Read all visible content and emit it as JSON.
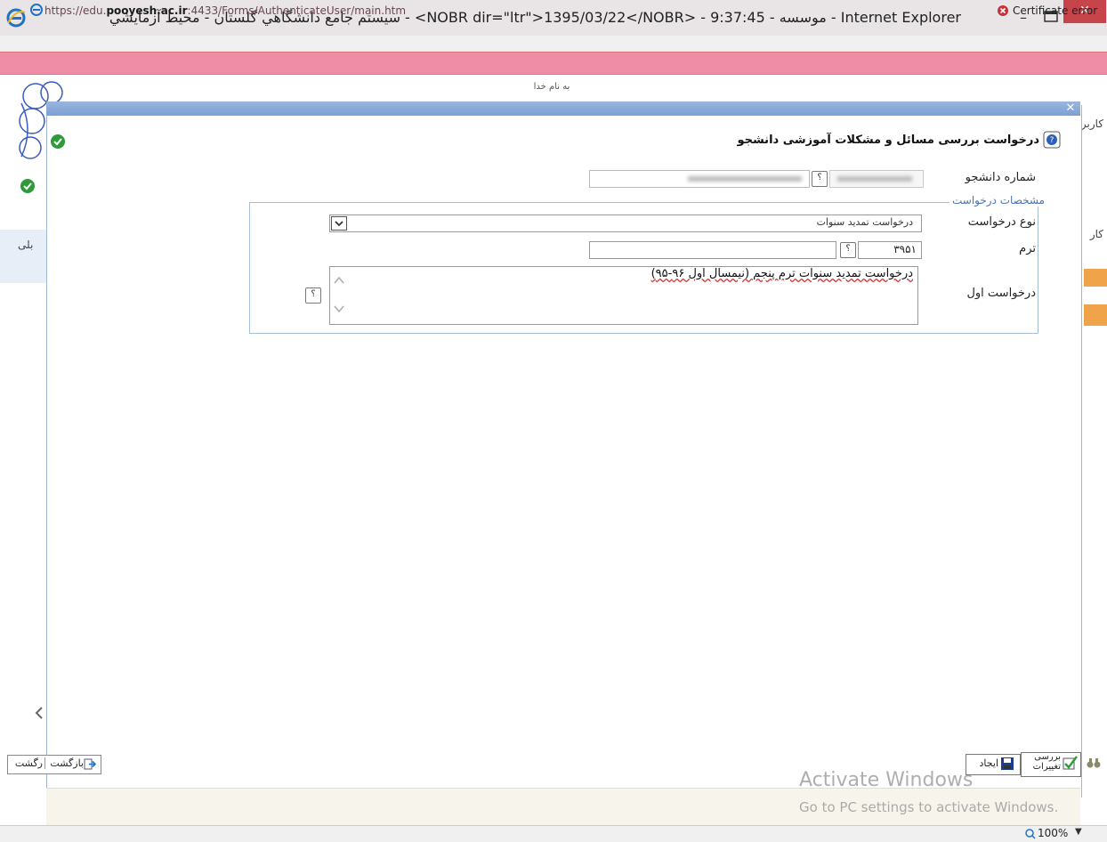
{
  "window": {
    "title": "سیستم جامع دانشگاهي گلستان - محيط آزمايشي - <NOBR dir=\"ltr\">1395/03/22</NOBR> - 9:37:45 - موسسه - Internet Explorer",
    "min_glyph": "–",
    "close_glyph": "✕"
  },
  "address": {
    "url_prefix": "https://edu.",
    "url_host": "pooyesh.ac.ir",
    "url_suffix": ":4433/Forms/AuthenticateUser/main.htm",
    "cert_label": "Certificate error"
  },
  "page": {
    "header_text": "به نام خدا",
    "right_col": [
      "کاربر",
      "کار"
    ],
    "left_text": "بلی"
  },
  "form": {
    "title": "درخواست بررسی مسائل و مشکلات آموزشی دانشجو",
    "student_id_label": "شماره دانشجو",
    "fieldset_legend": "مشخصات درخواست",
    "type_label": "نوع درخواست",
    "type_value": "درخواست تمدید سنوات",
    "term_label": "ترم",
    "term_value": "۳۹۵۱",
    "first_request_label": "درخواست اول",
    "first_request_text": "درخواست تمدید سنوات ترم پنجم (نیمسال اول ۹۶-۹۵)",
    "help_glyph": "؟"
  },
  "buttons": {
    "back_label": "بازگشت",
    "back_label2": "رگشت",
    "create_label": "ایجاد",
    "review_label_line1": "بررسی",
    "review_label_line2": "تغییرات"
  },
  "watermark": {
    "title": "Activate Windows",
    "subtitle": "Go to PC settings to activate Windows."
  },
  "status": {
    "zoom": "100%"
  },
  "colors": {
    "address_bar": "#ef8da7",
    "close_button": "#c7454a",
    "modal_bar": "#7aa0d3",
    "legend_text": "#4a74b2",
    "ok_green": "#2e9b3a"
  }
}
